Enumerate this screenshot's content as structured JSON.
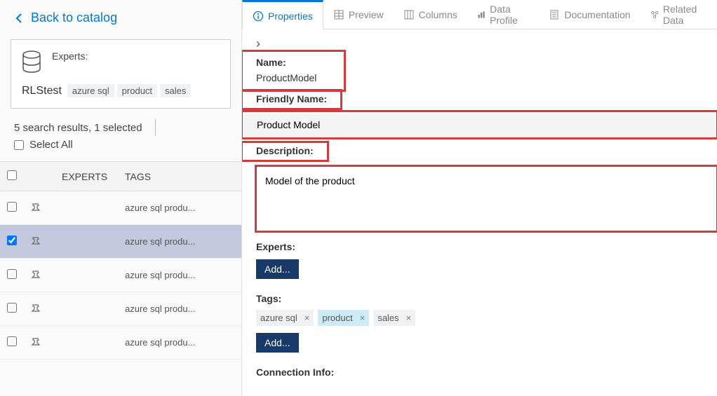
{
  "back_link": "Back to catalog",
  "card": {
    "experts_label": "Experts:",
    "name": "RLStest",
    "tags": [
      "azure sql",
      "product",
      "sales"
    ]
  },
  "summary": {
    "text": "5 search results, 1 selected",
    "select_all": "Select All"
  },
  "table": {
    "headers": {
      "experts": "EXPERTS",
      "tags": "TAGS"
    },
    "rows": [
      {
        "selected": false,
        "tags": "azure sql produ..."
      },
      {
        "selected": true,
        "tags": "azure sql produ..."
      },
      {
        "selected": false,
        "tags": "azure sql produ..."
      },
      {
        "selected": false,
        "tags": "azure sql produ..."
      },
      {
        "selected": false,
        "tags": "azure sql produ..."
      }
    ]
  },
  "tabs": {
    "properties": "Properties",
    "preview": "Preview",
    "columns": "Columns",
    "data_profile": "Data Profile",
    "documentation": "Documentation",
    "related_data": "Related Data"
  },
  "props": {
    "name_label": "Name:",
    "name_value": "ProductModel",
    "friendly_label": "Friendly Name:",
    "friendly_value": "Product Model",
    "description_label": "Description:",
    "description_value": "Model of the product",
    "experts_label": "Experts:",
    "tags_label": "Tags:",
    "connection_label": "Connection Info:",
    "add_btn": "Add...",
    "tags": [
      {
        "label": "azure sql",
        "active": false
      },
      {
        "label": "product",
        "active": true
      },
      {
        "label": "sales",
        "active": false
      }
    ]
  }
}
